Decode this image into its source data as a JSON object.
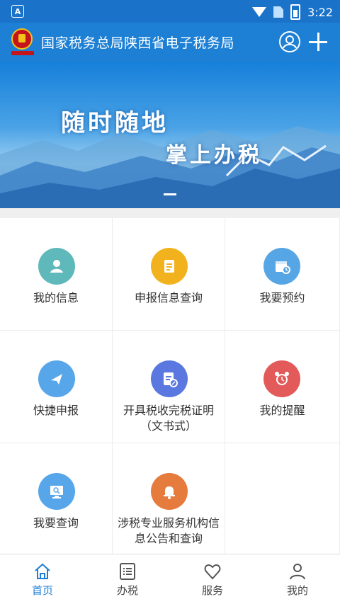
{
  "status_bar": {
    "time": "3:22",
    "notification_icon": "A"
  },
  "header": {
    "title": "国家税务总局陕西省电子税务局",
    "logo_icon": "tax-emblem",
    "user_icon": "user-icon",
    "add_icon": "plus-icon"
  },
  "banner": {
    "slogan_line1": "随时随地",
    "slogan_line2": "掌上办税"
  },
  "services": [
    {
      "label": "我的信息",
      "icon": "user-icon",
      "color": "#5fb8b9"
    },
    {
      "label": "申报信息查询",
      "icon": "document-icon",
      "color": "#f2b21e"
    },
    {
      "label": "我要预约",
      "icon": "calendar-clock-icon",
      "color": "#56a6e6"
    },
    {
      "label": "快捷申报",
      "icon": "paper-plane-icon",
      "color": "#58a6ea"
    },
    {
      "label": "开具税收完税证明（文书式）",
      "icon": "certificate-edit-icon",
      "color": "#5a78e0"
    },
    {
      "label": "我的提醒",
      "icon": "alarm-clock-icon",
      "color": "#e25a5a"
    },
    {
      "label": "我要查询",
      "icon": "monitor-search-icon",
      "color": "#58a6ea"
    },
    {
      "label": "涉税专业服务机构信息公告和查询",
      "icon": "bell-icon",
      "color": "#e57b3c"
    }
  ],
  "tabbar": {
    "items": [
      {
        "label": "首页",
        "icon": "home-icon"
      },
      {
        "label": "办税",
        "icon": "list-icon"
      },
      {
        "label": "服务",
        "icon": "heart-icon"
      },
      {
        "label": "我的",
        "icon": "person-icon"
      }
    ],
    "active_color": "#1d80d5"
  }
}
